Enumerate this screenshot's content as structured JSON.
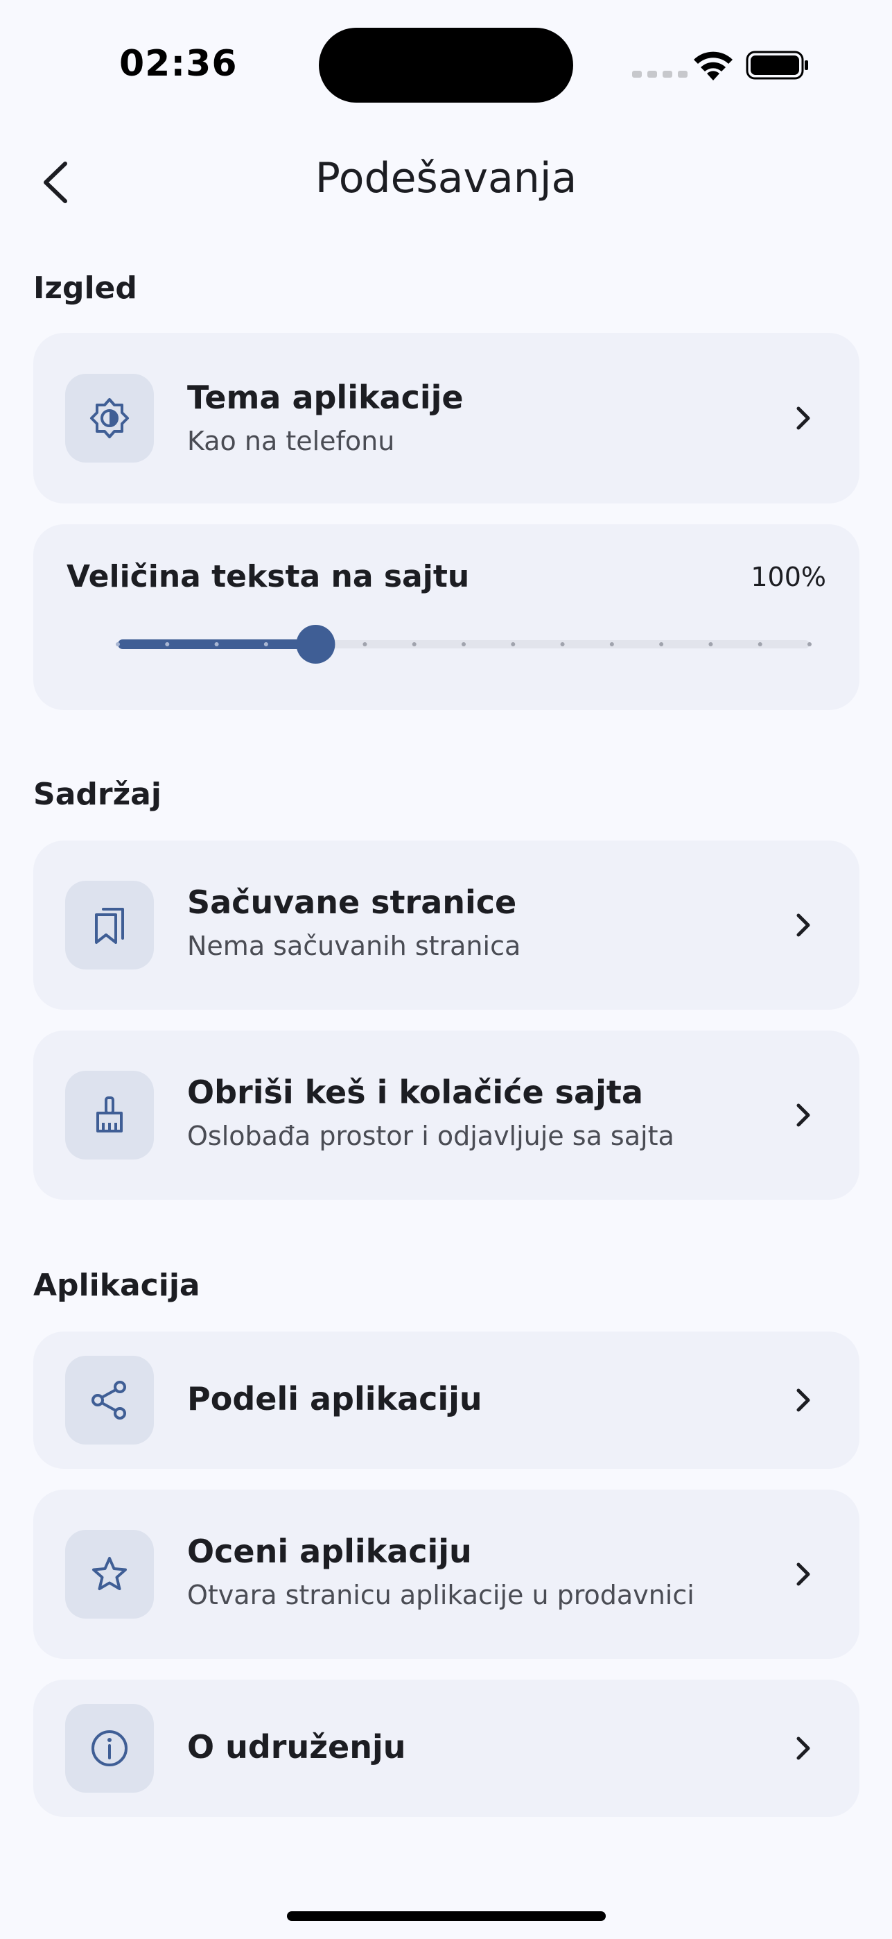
{
  "status_bar": {
    "time": "02:36"
  },
  "header": {
    "title": "Podešavanja"
  },
  "sections": {
    "appearance": {
      "title": "Izgled",
      "theme": {
        "title": "Tema aplikacije",
        "subtitle": "Kao na telefonu",
        "icon": "theme-icon"
      },
      "text_size": {
        "label": "Veličina teksta na sajtu",
        "value": "100%",
        "level_fraction": 0.286,
        "steps": 15,
        "selected_step": 4
      }
    },
    "content": {
      "title": "Sadržaj",
      "saved": {
        "title": "Sačuvane stranice",
        "subtitle": "Nema sačuvanih stranica",
        "icon": "bookmarks-icon"
      },
      "clear": {
        "title": "Obriši keš i kolačiće sajta",
        "subtitle": "Oslobađa prostor i odjavljuje sa sajta",
        "icon": "broom-icon"
      }
    },
    "app": {
      "title": "Aplikacija",
      "share": {
        "title": "Podeli aplikaciju",
        "icon": "share-icon"
      },
      "rate": {
        "title": "Oceni aplikaciju",
        "subtitle": "Otvara stranicu aplikacije u prodavnici",
        "icon": "star-icon"
      },
      "about": {
        "title": "O udruženju",
        "icon": "info-icon"
      }
    }
  },
  "colors": {
    "accent": "#3F5E95",
    "card": "#EFF1F9",
    "icon_bg": "#DDE2EE",
    "background": "#F8F9FE"
  }
}
